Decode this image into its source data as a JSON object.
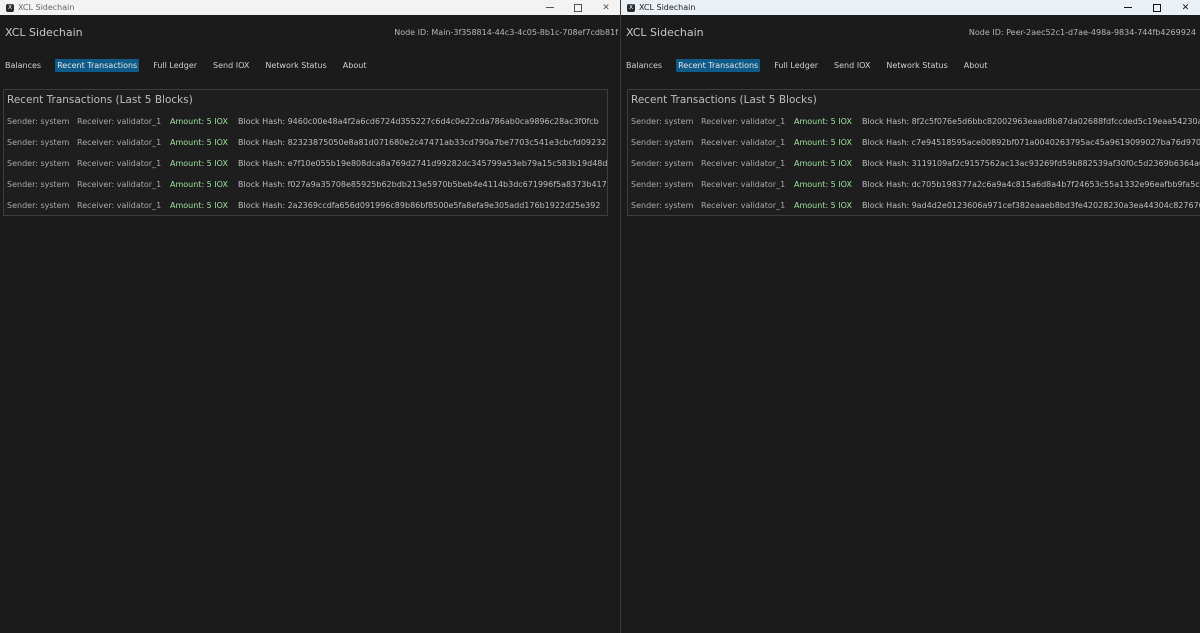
{
  "windows": [
    {
      "title": "XCL Sidechain",
      "app_icon_letter": "X",
      "app_title": "XCL Sidechain",
      "node_id": "Node ID: Main-3f358814-44c3-4c05-8b1c-708ef7cdb81f",
      "tabs": [
        "Balances",
        "Recent Transactions",
        "Full Ledger",
        "Send IOX",
        "Network Status",
        "About"
      ],
      "active_tab": "Recent Transactions",
      "panel_title": "Recent Transactions (Last 5 Blocks)",
      "transactions": [
        {
          "sender": "Sender: system",
          "receiver": "Receiver: validator_1",
          "amount": "Amount: 5 IOX",
          "hash": "Block Hash: 9460c00e48a4f2a6cd6724d355227c6d4c0e22cda786ab0ca9896c28ac3f0fcb"
        },
        {
          "sender": "Sender: system",
          "receiver": "Receiver: validator_1",
          "amount": "Amount: 5 IOX",
          "hash": "Block Hash: 82323875050e8a81d071680e2c47471ab33cd790a7be7703c541e3cbcfd09232"
        },
        {
          "sender": "Sender: system",
          "receiver": "Receiver: validator_1",
          "amount": "Amount: 5 IOX",
          "hash": "Block Hash: e7f10e055b19e808dca8a769d2741d99282dc345799a53eb79a15c583b19d48d"
        },
        {
          "sender": "Sender: system",
          "receiver": "Receiver: validator_1",
          "amount": "Amount: 5 IOX",
          "hash": "Block Hash: f027a9a35708e85925b62bdb213e5970b5beb4e4114b3dc671996f5a8373b417"
        },
        {
          "sender": "Sender: system",
          "receiver": "Receiver: validator_1",
          "amount": "Amount: 5 IOX",
          "hash": "Block Hash: 2a2369ccdfa656d091996c89b86bf8500e5fa8efa9e305add176b1922d25e392"
        }
      ]
    },
    {
      "title": "XCL Sidechain",
      "app_icon_letter": "X",
      "app_title": "XCL Sidechain",
      "node_id": "Node ID: Peer-2aec52c1-d7ae-498a-9834-744fb4269924",
      "tabs": [
        "Balances",
        "Recent Transactions",
        "Full Ledger",
        "Send IOX",
        "Network Status",
        "About"
      ],
      "active_tab": "Recent Transactions",
      "panel_title": "Recent Transactions (Last 5 Blocks)",
      "transactions": [
        {
          "sender": "Sender: system",
          "receiver": "Receiver: validator_1",
          "amount": "Amount: 5 IOX",
          "hash": "Block Hash: 8f2c5f076e5d6bbc82002963eaad8b87da02688fdfccded5c19eaa54230a9"
        },
        {
          "sender": "Sender: system",
          "receiver": "Receiver: validator_1",
          "amount": "Amount: 5 IOX",
          "hash": "Block Hash: c7e94518595ace00892bf071a0040263795ac45a9619099027ba76d9706"
        },
        {
          "sender": "Sender: system",
          "receiver": "Receiver: validator_1",
          "amount": "Amount: 5 IOX",
          "hash": "Block Hash: 3119109af2c9157562ac13ac93269fd59b882539af30f0c5d2369b6364a0"
        },
        {
          "sender": "Sender: system",
          "receiver": "Receiver: validator_1",
          "amount": "Amount: 5 IOX",
          "hash": "Block Hash: dc705b198377a2c6a9a4c815a6d8a4b7f24653c55a1332e96eafbb9fa5ce"
        },
        {
          "sender": "Sender: system",
          "receiver": "Receiver: validator_1",
          "amount": "Amount: 5 IOX",
          "hash": "Block Hash: 9ad4d2e0123606a971cef382eaaeb8bd3fe42028230a3ea44304c8276764"
        }
      ]
    }
  ],
  "colors": {
    "background": "#1b1b1b",
    "active_tab": "#0e5a88",
    "amount_text": "#9ee39e",
    "panel_border": "#3d3d3d"
  }
}
